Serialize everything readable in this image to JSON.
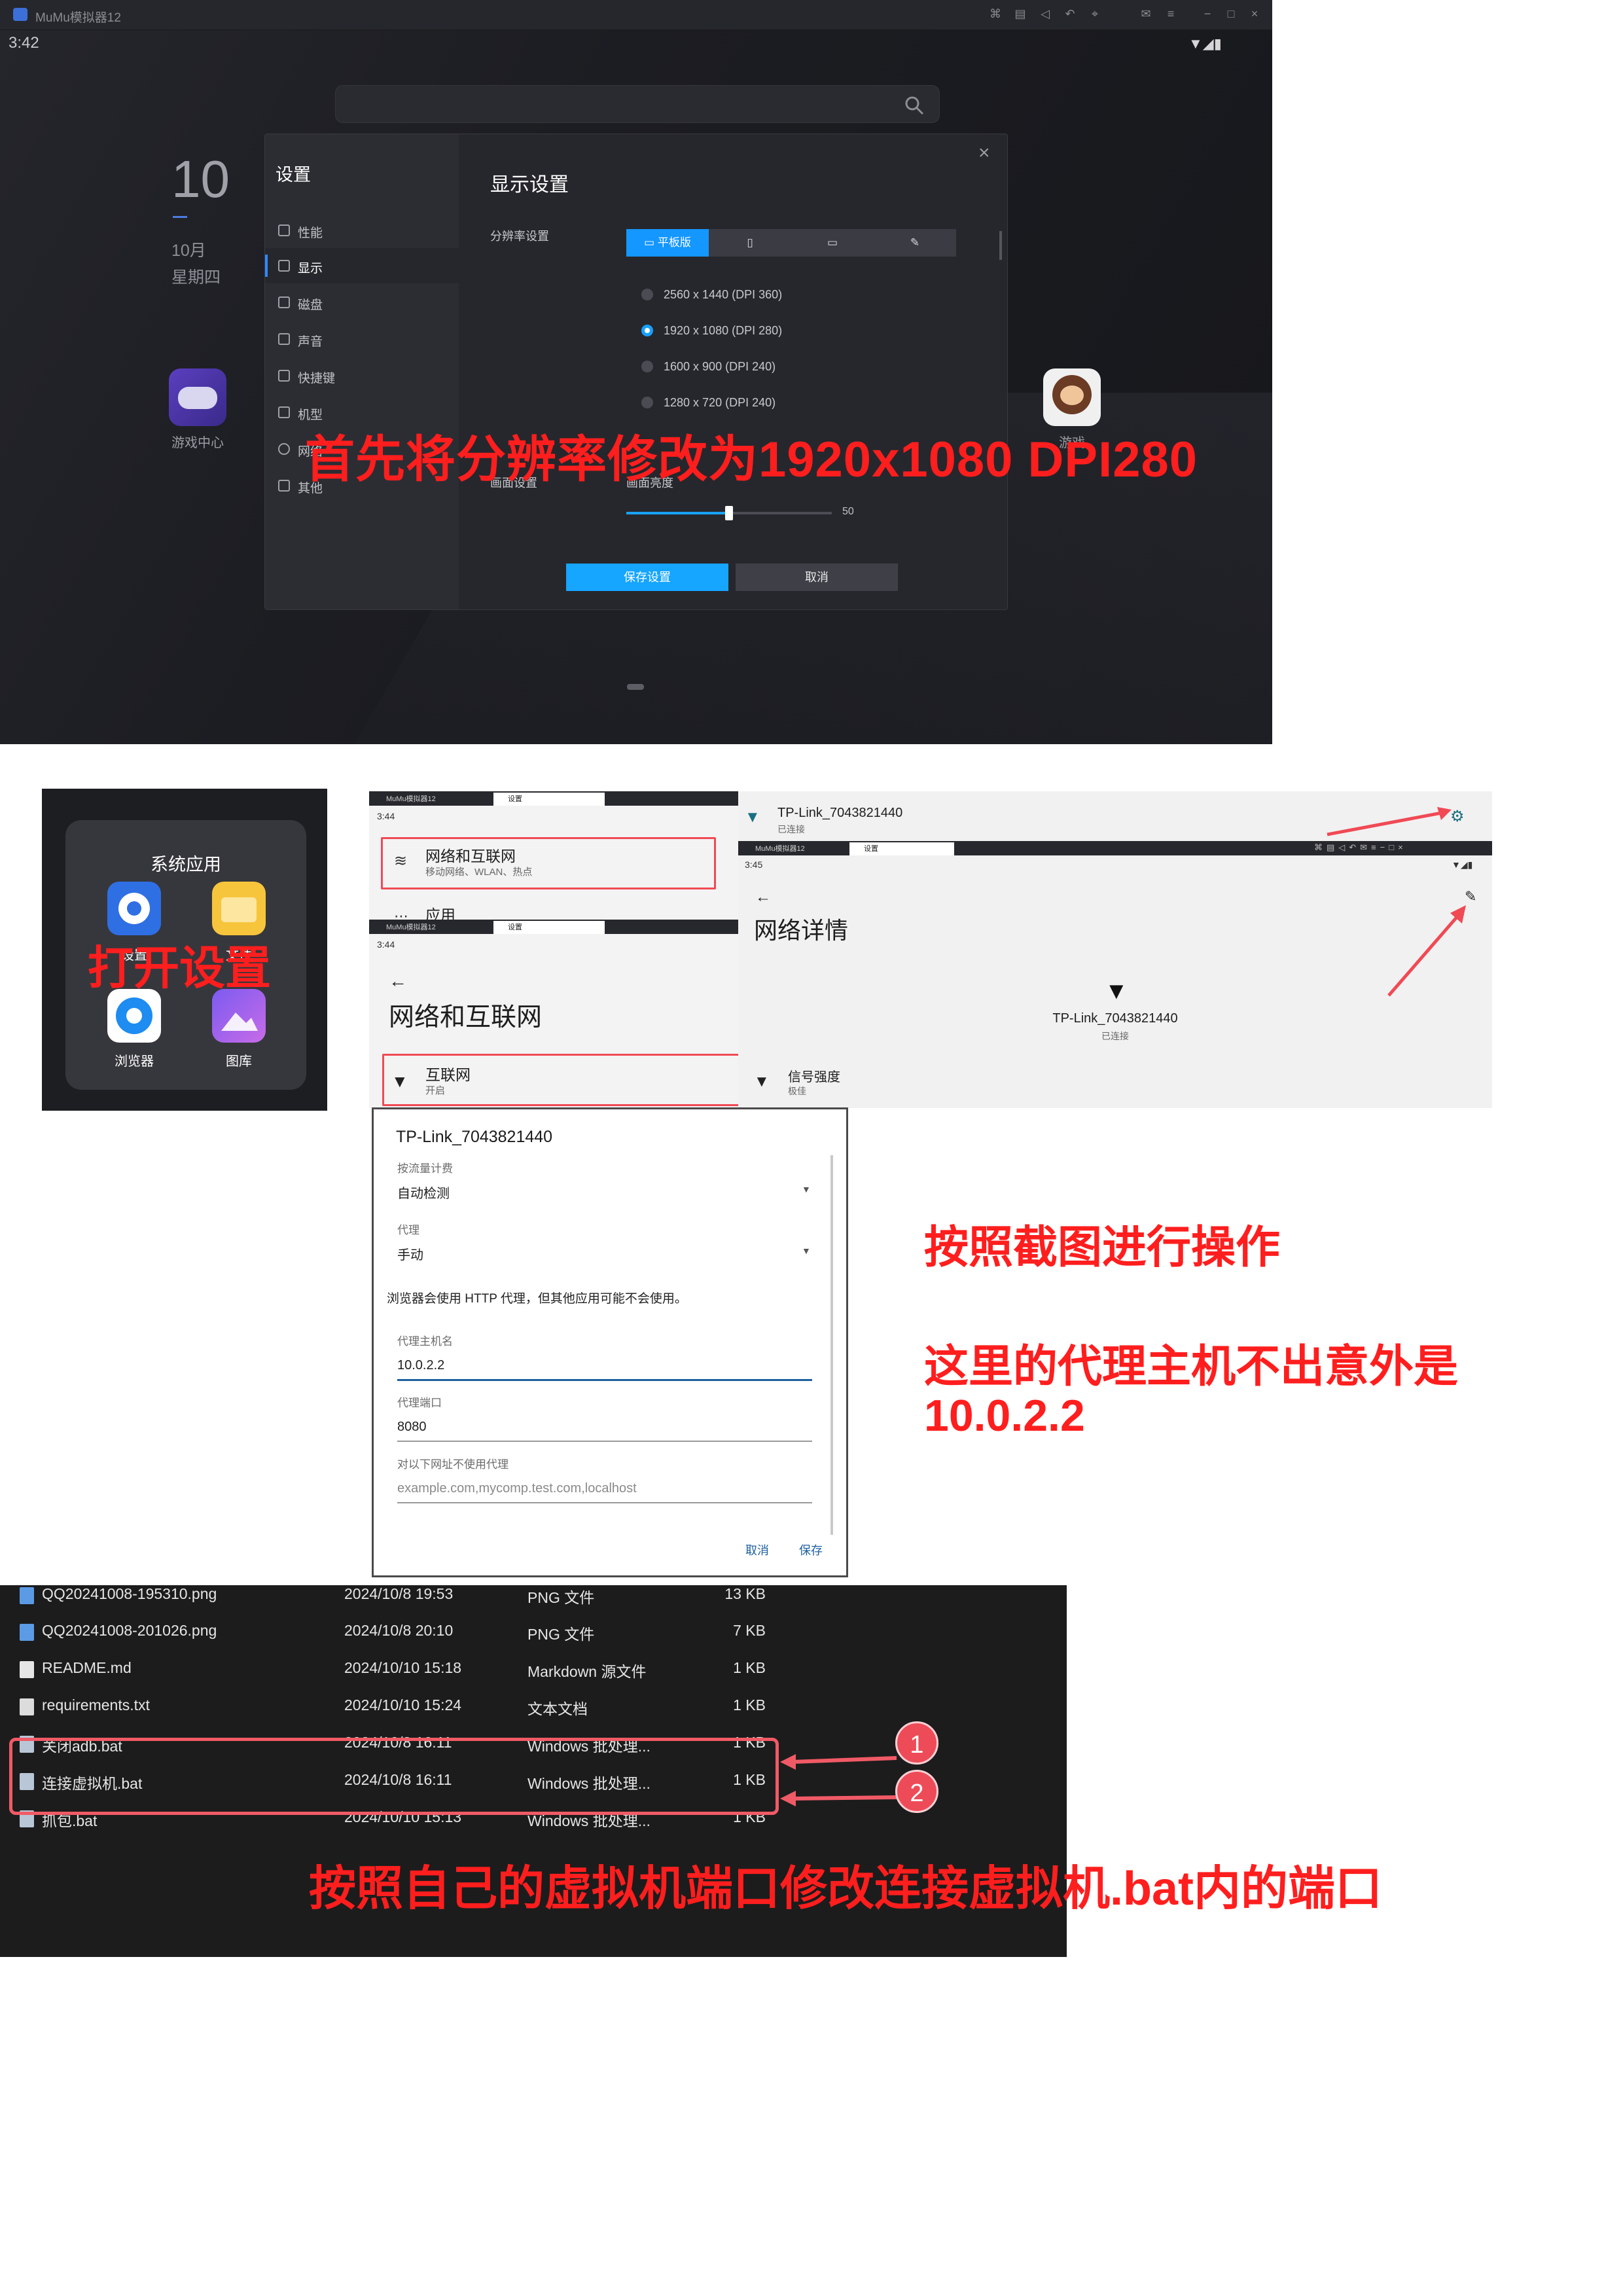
{
  "emulator": {
    "window_title": "MuMu模拟器12",
    "status_time": "3:42",
    "clock": "10",
    "month": "10月",
    "weekday": "星期四",
    "apps": [
      {
        "label": "游戏中心",
        "icon": "gamepad-icon"
      },
      {
        "label": "游戏",
        "icon": "monkey-game-icon"
      }
    ],
    "settings_dialog": {
      "title": "设置",
      "menu": [
        {
          "label": "性能",
          "active": false
        },
        {
          "label": "显示",
          "active": true
        },
        {
          "label": "磁盘",
          "active": false
        },
        {
          "label": "声音",
          "active": false
        },
        {
          "label": "快捷键",
          "active": false
        },
        {
          "label": "机型",
          "active": false
        },
        {
          "label": "网络",
          "active": false
        },
        {
          "label": "其他",
          "active": false
        }
      ],
      "page_title": "显示设置",
      "resolution_label": "分辨率设置",
      "resolution_tabs": [
        "平板版",
        "",
        "",
        ""
      ],
      "resolution_options": [
        {
          "label": "2560 x 1440 (DPI 360)",
          "selected": false
        },
        {
          "label": "1920 x 1080 (DPI 280)",
          "selected": true
        },
        {
          "label": "1600 x 900 (DPI 240)",
          "selected": false
        },
        {
          "label": "1280 x 720 (DPI 240)",
          "selected": false
        }
      ],
      "screen_label": "画面设置",
      "brightness_label": "画面亮度",
      "brightness_value": "50",
      "brightness_fraction": 0.5,
      "save_label": "保存设置",
      "cancel_label": "取消"
    }
  },
  "annotations": {
    "resolution": "首先将分辨率修改为1920x1080 DPI280",
    "open_settings": "打开设置",
    "follow_screens": "按照截图进行操作",
    "proxy_host_line1": "这里的代理主机不出意外是",
    "proxy_host_line2": "10.0.2.2",
    "bat_port": "按照自己的虚拟机端口修改连接虚拟机.bat内的端口"
  },
  "system_apps": {
    "title": "系统应用",
    "apps": [
      {
        "label": "设置",
        "icon": "settings-gear-icon"
      },
      {
        "label": "文件",
        "icon": "folder-icon"
      },
      {
        "label": "浏览器",
        "icon": "browser-icon"
      },
      {
        "label": "图库",
        "icon": "gallery-icon"
      }
    ]
  },
  "android": {
    "tab_emulator": "MuMu模拟器12",
    "tab_settings": "设置",
    "times": [
      "3:44",
      "3:44",
      "3:45"
    ],
    "network_item": {
      "title": "网络和互联网",
      "subtitle": "移动网络、WLAN、热点"
    },
    "apps_item": "应用",
    "network_page_title": "网络和互联网",
    "internet_item": {
      "title": "互联网",
      "subtitle": "开启"
    },
    "wifi_name": "TP-Link_7043821440",
    "wifi_status": "已连接",
    "details_title": "网络详情",
    "signal_label": "信号强度",
    "signal_value": "极佳"
  },
  "proxy_dialog": {
    "title": "TP-Link_7043821440",
    "metered_label": "按流量计费",
    "metered_value": "自动检测",
    "proxy_label": "代理",
    "proxy_value": "手动",
    "note": "浏览器会使用 HTTP 代理，但其他应用可能不会使用。",
    "host_label": "代理主机名",
    "host_value": "10.0.2.2",
    "port_label": "代理端口",
    "port_value": "8080",
    "bypass_label": "对以下网址不使用代理",
    "bypass_placeholder": "example.com,mycomp.test.com,localhost",
    "cancel_label": "取消",
    "save_label": "保存"
  },
  "explorer": {
    "files": [
      {
        "name": "QQ20241008-195310.png",
        "date": "2024/10/8 19:53",
        "type": "PNG 文件",
        "size": "13 KB"
      },
      {
        "name": "QQ20241008-201026.png",
        "date": "2024/10/8 20:10",
        "type": "PNG 文件",
        "size": "7 KB"
      },
      {
        "name": "README.md",
        "date": "2024/10/10 15:18",
        "type": "Markdown 源文件",
        "size": "1 KB"
      },
      {
        "name": "requirements.txt",
        "date": "2024/10/10 15:24",
        "type": "文本文档",
        "size": "1 KB"
      },
      {
        "name": "关闭adb.bat",
        "date": "2024/10/8 16:11",
        "type": "Windows 批处理...",
        "size": "1 KB"
      },
      {
        "name": "连接虚拟机.bat",
        "date": "2024/10/8 16:11",
        "type": "Windows 批处理...",
        "size": "1 KB"
      },
      {
        "name": "抓包.bat",
        "date": "2024/10/10 15:13",
        "type": "Windows 批处理...",
        "size": "1 KB"
      }
    ],
    "badges": [
      "1",
      "2"
    ]
  },
  "colors": {
    "accent": "#16a5ff",
    "annotation": "#ff1e1e",
    "highlight": "#f05a66"
  }
}
